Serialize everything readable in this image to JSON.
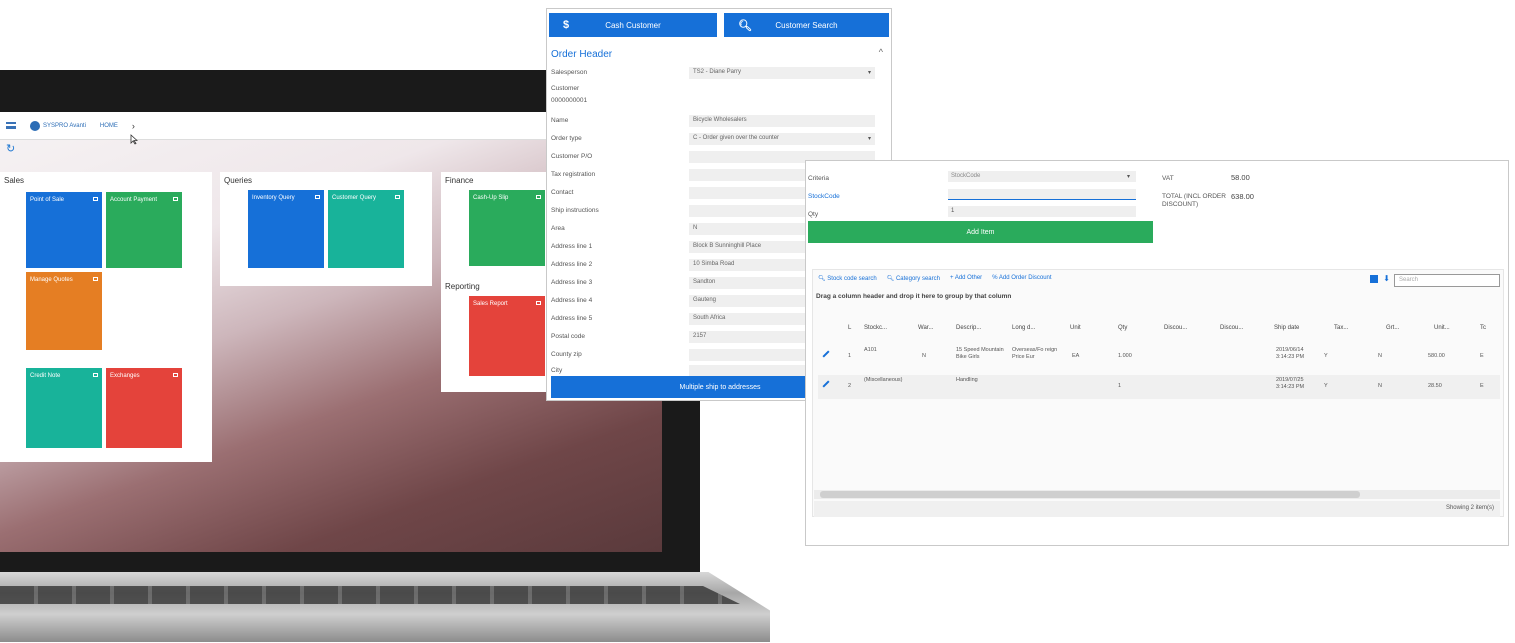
{
  "laptop": {
    "topbar": {
      "brand": "SYSPRO Avanti",
      "crumb": "HOME",
      "chevron": "›"
    },
    "refresh_icon": "↻",
    "panels": {
      "sales": {
        "title": "Sales"
      },
      "queries": {
        "title": "Queries"
      },
      "finance": {
        "title": "Finance"
      },
      "reporting": {
        "title": "Reporting"
      }
    },
    "tiles": {
      "point_of_sale": "Point of Sale",
      "account_payment": "Account Payment",
      "manage_quotes": "Manage Quotes",
      "credit_note": "Credit Note",
      "exchanges": "Exchanges",
      "inventory_query": "Inventory Query",
      "customer_query": "Customer Query",
      "cash_up_slip": "Cash-Up Slip",
      "sales_report": "Sales Report"
    }
  },
  "order_window": {
    "cash_customer": {
      "icon": "$",
      "label": "Cash Customer"
    },
    "customer_search": {
      "icon": "🔍︎",
      "label": "Customer Search"
    },
    "header_title": "Order Header",
    "collapse_icon": "^",
    "fields": [
      {
        "label": "Salesperson",
        "value": "TS2 - Diane Parry",
        "dropdown": true
      },
      {
        "label": "Customer",
        "value": "",
        "dropdown": false
      },
      {
        "label": "0000000001",
        "value": "",
        "dropdown": false
      },
      {
        "label": "Name",
        "value": "Bicycle Wholesalers",
        "dropdown": false
      },
      {
        "label": "Order type",
        "value": "C - Order given over the counter",
        "dropdown": true
      },
      {
        "label": "Customer P/O",
        "value": "",
        "dropdown": false
      },
      {
        "label": "Tax registration",
        "value": "",
        "dropdown": false
      },
      {
        "label": "Contact",
        "value": "",
        "dropdown": false
      },
      {
        "label": "Ship instructions",
        "value": "",
        "dropdown": false
      },
      {
        "label": "Area",
        "value": "N",
        "dropdown": false
      },
      {
        "label": "Address line 1",
        "value": "Block B Sunninghill Place",
        "dropdown": false
      },
      {
        "label": "Address line 2",
        "value": "10 Simba Road",
        "dropdown": false
      },
      {
        "label": "Address line 3",
        "value": "Sandton",
        "dropdown": false
      },
      {
        "label": "Address line 4",
        "value": "Gauteng",
        "dropdown": false
      },
      {
        "label": "Address line 5",
        "value": "South Africa",
        "dropdown": false
      },
      {
        "label": "Postal code",
        "value": "2157",
        "dropdown": false
      },
      {
        "label": "County zip",
        "value": "",
        "dropdown": false
      },
      {
        "label": "City",
        "value": "",
        "dropdown": false
      }
    ],
    "multiple_ship": "Multiple ship to addresses"
  },
  "items_window": {
    "criteria_label": "Criteria",
    "criteria_value": "StockCode",
    "stockcode_label": "StockCode",
    "qty_label": "Qty",
    "qty_value": "1",
    "vat_label": "VAT",
    "vat_value": "58.00",
    "total_label": "TOTAL (INCL ORDER DISCOUNT)",
    "total_value": "638.00",
    "add_item": "Add Item",
    "toolbar": [
      "Stock code search",
      "Category search",
      "Add Other",
      "Add Order Discount"
    ],
    "search_placeholder": "Search",
    "group_hint": "Drag a column header and drop it here to group by that column",
    "columns": [
      "L",
      "Stockc...",
      "War...",
      "Descrip...",
      "Long d...",
      "Unit",
      "Qty",
      "Discou...",
      "Discou...",
      "Ship date",
      "Tax...",
      "Grt...",
      "Unit...",
      "Tc"
    ],
    "rows": [
      {
        "line": "1",
        "stock": "A101",
        "warehouse": "N",
        "desc": "15 Speed Mountain Bike Girls",
        "long": "Overseas/Fo reign Price Eur",
        "unit": "EA",
        "qty": "1.000",
        "ship": "2019/06/14 3:14:23 PM",
        "tax": "Y",
        "grt": "N",
        "price": "580.00",
        "tc": "E"
      },
      {
        "line": "2",
        "stock": "(Miscellaneous)",
        "warehouse": "",
        "desc": "Handling",
        "long": "",
        "unit": "",
        "qty": "1",
        "ship": "2019/07/25 3:14:23 PM",
        "tax": "Y",
        "grt": "N",
        "price": "28.50",
        "tc": "E"
      }
    ],
    "showing": "Showing 2 item(s)"
  }
}
